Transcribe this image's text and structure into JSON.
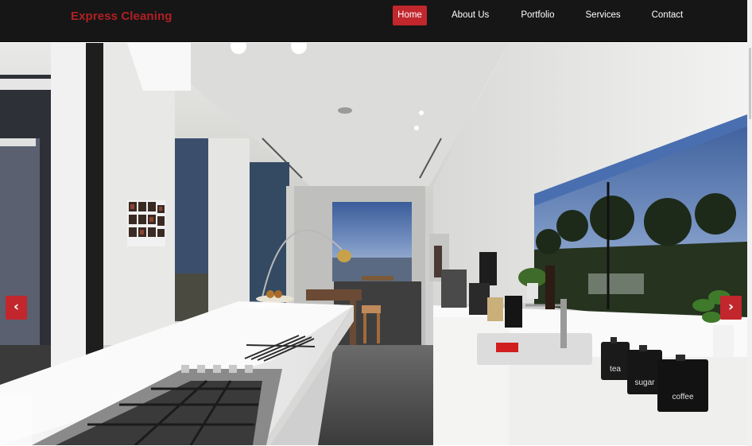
{
  "site": {
    "brand": "Express Cleaning"
  },
  "nav": {
    "items": [
      {
        "label": "Home",
        "active": true
      },
      {
        "label": "About Us"
      },
      {
        "label": "Portfolio"
      },
      {
        "label": "Services"
      },
      {
        "label": "Contact"
      }
    ]
  },
  "carousel": {
    "prev_glyph": "‹",
    "next_glyph": "›",
    "canister_labels": [
      "tea",
      "sugar",
      "coffee"
    ]
  },
  "colors": {
    "accent": "#c1272d",
    "brand_text": "#b21f24",
    "navbar_bg": "#161616"
  },
  "icons": {
    "prev": "chevron-left-icon",
    "next": "chevron-right-icon"
  }
}
